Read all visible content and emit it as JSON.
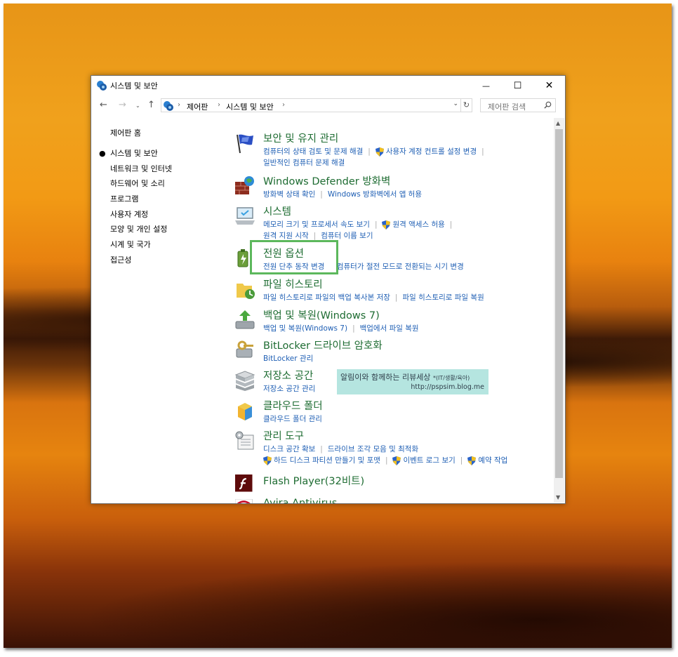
{
  "window": {
    "title": "시스템 및 보안",
    "controls": {
      "minimize": "—",
      "maximize": "☐",
      "close": "✕"
    }
  },
  "address_bar": {
    "breadcrumbs": [
      "제어판",
      "시스템 및 보안"
    ],
    "search_placeholder": "제어판 검색"
  },
  "sidebar": {
    "home": "제어판 홈",
    "items": [
      {
        "label": "시스템 및 보안",
        "current": true
      },
      {
        "label": "네트워크 및 인터넷"
      },
      {
        "label": "하드웨어 및 소리"
      },
      {
        "label": "프로그램"
      },
      {
        "label": "사용자 계정"
      },
      {
        "label": "모양 및 개인 설정"
      },
      {
        "label": "시계 및 국가"
      },
      {
        "label": "접근성"
      }
    ]
  },
  "categories": [
    {
      "title": "보안 및 유지 관리",
      "icon": "flag-icon",
      "links": [
        [
          "컴퓨터의 상태 검토 및 문제 해결",
          "사용자 계정 컨트롤 설정 변경"
        ],
        [
          "일반적인 컴퓨터 문제 해결"
        ]
      ]
    },
    {
      "title": "Windows Defender 방화벽",
      "icon": "firewall-icon",
      "links": [
        [
          "방화벽 상태 확인",
          "Windows 방화벽에서 앱 허용"
        ]
      ]
    },
    {
      "title": "시스템",
      "icon": "computer-icon",
      "links": [
        [
          "메모리 크기 및 프로세서 속도 보기",
          "원격 액세스 허용"
        ],
        [
          "원격 지원 시작",
          "컴퓨터 이름 보기"
        ]
      ]
    },
    {
      "title": "전원 옵션",
      "icon": "battery-icon",
      "links": [
        [
          "전원 단추 동작 변경",
          "컴퓨터가 절전 모드로 전환되는 시기 변경"
        ]
      ]
    },
    {
      "title": "파일 히스토리",
      "icon": "folder-history-icon",
      "links": [
        [
          "파일 히스토리로 파일의 백업 복사본 저장",
          "파일 히스토리로 파일 복원"
        ]
      ]
    },
    {
      "title": "백업 및 복원(Windows 7)",
      "icon": "backup-icon",
      "links": [
        [
          "백업 및 복원(Windows 7)",
          "백업에서 파일 복원"
        ]
      ]
    },
    {
      "title": "BitLocker 드라이브 암호화",
      "icon": "bitlocker-icon",
      "links": [
        [
          "BitLocker 관리"
        ]
      ]
    },
    {
      "title": "저장소 공간",
      "icon": "storage-icon",
      "links": [
        [
          "저장소 공간 관리"
        ]
      ]
    },
    {
      "title": "클라우드 폴더",
      "icon": "work-folders-icon",
      "links": [
        [
          "클라우드 폴더 관리"
        ]
      ]
    },
    {
      "title": "관리 도구",
      "icon": "admin-tools-icon",
      "links": [
        [
          "디스크 공간 확보",
          "드라이브 조각 모음 및 최적화"
        ],
        [
          "하드 디스크 파티션 만들기 및 포맷",
          "이벤트 로그 보기",
          "예약 작업"
        ]
      ]
    },
    {
      "title": "Flash Player(32비트)",
      "icon": "flash-icon",
      "links": []
    },
    {
      "title": "Avira Antivirus",
      "icon": "avira-icon",
      "links": []
    }
  ],
  "watermark": {
    "line1": "알림이와 함께하는 리뷰세상",
    "line1_small": "*(IT/생활/육아)",
    "line2": "http://pspsim.blog.me"
  },
  "colors": {
    "title_green": "#1e6c32",
    "link_blue": "#1f5fb4",
    "highlight": "#5cb85c"
  }
}
